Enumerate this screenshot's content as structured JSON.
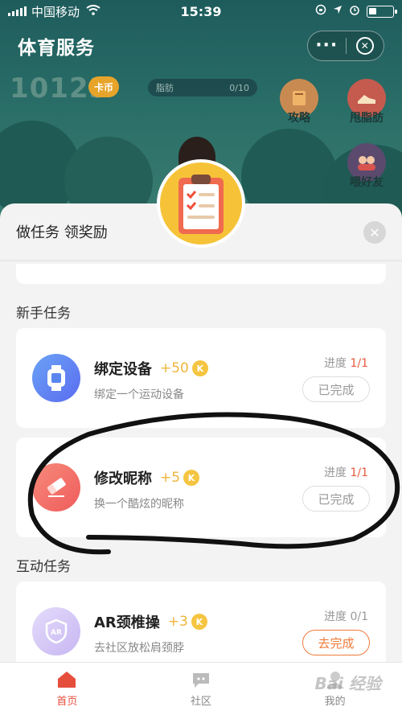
{
  "status_bar": {
    "carrier": "中国移动",
    "time": "15:39"
  },
  "header": {
    "title": "体育服务",
    "more_label": "···"
  },
  "game": {
    "coins": "10123",
    "coin_unit": "卡币",
    "fat_label": "脂肪",
    "fat_progress": "0/10",
    "side_buttons": [
      {
        "label": "攻略",
        "icon": "book-icon"
      },
      {
        "label": "甩脂肪",
        "icon": "shoe-icon"
      },
      {
        "label": "喂好友",
        "icon": "friends-icon"
      }
    ]
  },
  "sheet": {
    "title": "做任务 领奖励",
    "sections": [
      {
        "title": "新手任务"
      },
      {
        "title": "互动任务"
      }
    ],
    "tasks": [
      {
        "name": "绑定设备",
        "reward": "+50",
        "coin": "K",
        "desc": "绑定一个运动设备",
        "progress_label": "进度",
        "progress": "1/1",
        "button": "已完成",
        "icon": "watch-icon",
        "color": "#5b86f0"
      },
      {
        "name": "修改昵称",
        "reward": "+5",
        "coin": "K",
        "desc": "换一个酷炫的昵称",
        "progress_label": "进度",
        "progress": "1/1",
        "button": "已完成",
        "icon": "eraser-icon",
        "color": "#f06464"
      },
      {
        "name": "AR颈椎操",
        "reward": "+3",
        "coin": "K",
        "desc": "去社区放松肩颈脖",
        "progress_label": "进度",
        "progress": "0/1",
        "button": "去完成",
        "icon": "ar-icon",
        "color": "#c9b9f3"
      }
    ]
  },
  "tabbar": {
    "tabs": [
      {
        "label": "首页"
      },
      {
        "label": "社区"
      },
      {
        "label": "我的"
      }
    ]
  },
  "watermark": "Bai 经验"
}
